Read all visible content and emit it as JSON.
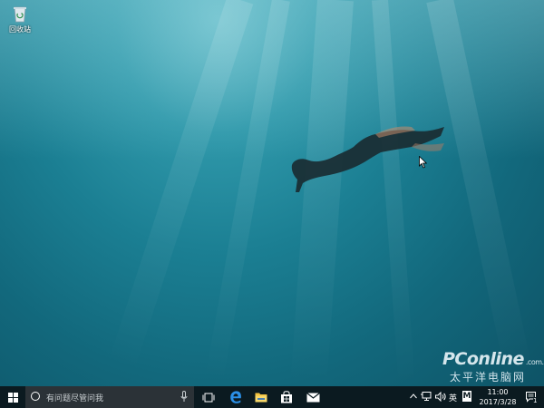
{
  "desktop": {
    "icons": [
      {
        "label": "回收站",
        "icon": "recycle-bin-icon"
      }
    ],
    "watermark": {
      "logo": "PConline",
      "logo_suffix": ".com.cn",
      "subtitle": "太平洋电脑网"
    }
  },
  "taskbar": {
    "start_icon": "windows-logo-icon",
    "search": {
      "placeholder": "有问题尽管问我"
    },
    "pinned": [
      {
        "name": "task-view",
        "icon": "task-view-icon"
      },
      {
        "name": "edge",
        "icon": "edge-icon",
        "color": "#1e90ff"
      },
      {
        "name": "file-explorer",
        "icon": "folder-icon",
        "color": "#f6c445"
      },
      {
        "name": "store",
        "icon": "store-icon"
      },
      {
        "name": "mail",
        "icon": "mail-icon"
      }
    ],
    "tray": {
      "ime_language": "英",
      "ime_mode": "M",
      "time": "11:00",
      "date": "2017/3/28",
      "notification_count": "1"
    }
  },
  "colors": {
    "taskbar": "#0b1a20",
    "search_box": "#2b3237",
    "water_light": "#6fc0cc",
    "water_dark": "#0e5366"
  }
}
